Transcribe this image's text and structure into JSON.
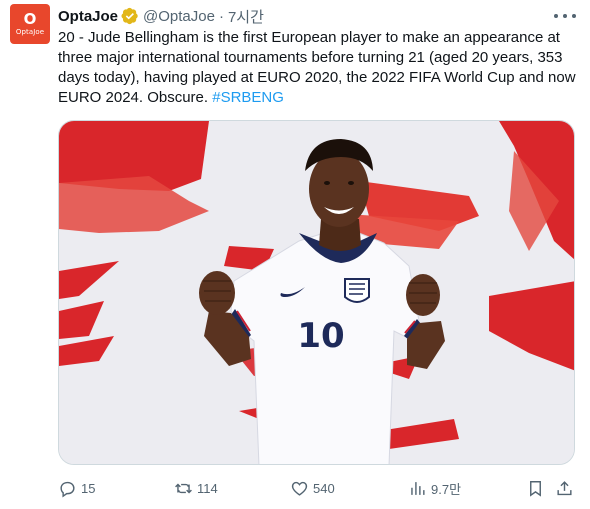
{
  "account": {
    "avatar_text_top": "O",
    "avatar_text_bottom": "OptaJoe",
    "name": "OptaJoe",
    "handle": "@OptaJoe",
    "separator": "·",
    "time": "7시간"
  },
  "tweet": {
    "text": "20 - Jude Bellingham is the first European player to make an appearance at three major international tournaments before turning 21 (aged 20 years, 353 days today), having played at EURO 2020, the 2022 FIFA World Cup and now EURO 2024. Obscure. ",
    "hashtag": "#SRBENG"
  },
  "media": {
    "shirt_number": "10"
  },
  "actions": {
    "replies": "15",
    "reposts": "114",
    "likes": "540",
    "views": "9.7만"
  },
  "colors": {
    "accent": "#1d9bf0",
    "brand": "#e8472c",
    "muted": "#536471",
    "verified": "#e2b719"
  }
}
